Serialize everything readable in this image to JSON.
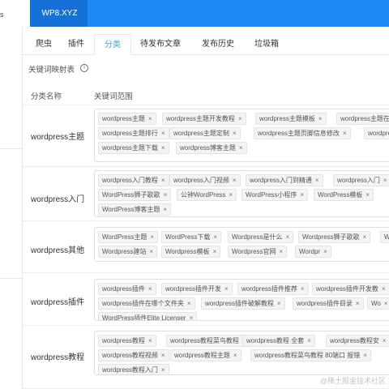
{
  "window": {
    "left_label": "s",
    "site_tab": "WP8.XYZ"
  },
  "tabs": [
    {
      "label": "爬虫"
    },
    {
      "label": "插件"
    },
    {
      "label": "分类"
    },
    {
      "label": "待发布文章"
    },
    {
      "label": "发布历史"
    },
    {
      "label": "垃圾箱"
    }
  ],
  "active_tab": "分类",
  "section": {
    "title": "关键词映射表",
    "info_icon": "i"
  },
  "table": {
    "headers": {
      "category": "分类名称",
      "keywords": "关键词范围"
    },
    "rows": [
      {
        "name": "wordpress主题",
        "tags": [
          "wordpress主题",
          "wordpress主题开发教程",
          "wordpress主题模板",
          "wordpress主题在",
          "wordpress主题排行",
          "wordpress主题定制",
          "wordpress主题页脚信息修改",
          "wordpress",
          "wordpress主题下载",
          "wordpress博客主题"
        ]
      },
      {
        "name": "wordpress入门",
        "tags": [
          "wordpress入门教程",
          "wordpress入门视频",
          "wordpress入门到精通",
          "wordpress入门",
          "WordPress狮子歌歌",
          "公钟WordPress",
          "WordPress小程序",
          "WordPress模板",
          "W",
          "WordPress博客主题"
        ]
      },
      {
        "name": "wordpress其他",
        "tags": [
          "WordPress主题",
          "WordPress下载",
          "Wordpress是什么",
          "Wordpress狮子歌歌",
          "WordPress插件",
          "Wordpress建站",
          "Wordpress模板",
          "Wordpress官网",
          "Wordpr"
        ]
      },
      {
        "name": "wordpress插件",
        "tags": [
          "wordpress插件",
          "wordpress插件开发",
          "wordpress插件推荐",
          "wordpress插件开发教",
          "wordpress插件在哪个文件夹",
          "wordpress插件破解教程",
          "wordpress插件目录",
          "Wo",
          "WordPress插件Elite Licenser"
        ]
      },
      {
        "name": "wordpress教程",
        "tags": [
          "wordpress教程",
          "wordpress教程菜鸟教程",
          "wordpress教程 全套",
          "wordpress教程安",
          "wordpress教程视频",
          "wordpress教程主题",
          "wordpress教程菜鸟教程 80端口 报错",
          "",
          "wordpress教程入门"
        ]
      }
    ]
  },
  "watermark": "@稀土掘金技术社区",
  "colors": {
    "accent": "#409eff",
    "topbar": "#1e88f5",
    "site_tab": "#1570d8"
  }
}
